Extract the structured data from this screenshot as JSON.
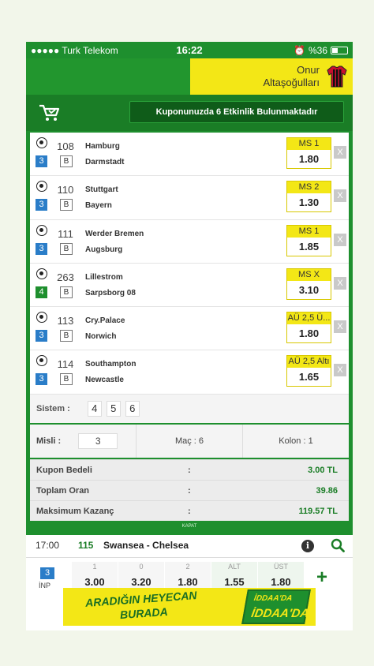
{
  "status": {
    "carrier": "●●●●● Turk Telekom",
    "time": "16:22",
    "battery": "%36"
  },
  "user": {
    "first_name": "Onur",
    "last_name": "Altaşoğulları"
  },
  "coupon": {
    "message": "Kuponunuzda 6 Etkinlik Bulunmaktadır"
  },
  "selections": [
    {
      "code": "108",
      "mbs": "3",
      "mbs_color": "#2a7dc8",
      "type": "B",
      "home": "Hamburg",
      "away": "Darmstadt",
      "bet_type": "MS 1",
      "odd": "1.80"
    },
    {
      "code": "110",
      "mbs": "3",
      "mbs_color": "#2a7dc8",
      "type": "B",
      "home": "Stuttgart",
      "away": "Bayern",
      "bet_type": "MS 2",
      "odd": "1.30"
    },
    {
      "code": "111",
      "mbs": "3",
      "mbs_color": "#2a7dc8",
      "type": "B",
      "home": "Werder Bremen",
      "away": "Augsburg",
      "bet_type": "MS 1",
      "odd": "1.85"
    },
    {
      "code": "263",
      "mbs": "4",
      "mbs_color": "#1e8f2e",
      "type": "B",
      "home": "Lillestrom",
      "away": "Sarpsborg 08",
      "bet_type": "MS X",
      "odd": "3.10"
    },
    {
      "code": "113",
      "mbs": "3",
      "mbs_color": "#2a7dc8",
      "type": "B",
      "home": "Cry.Palace",
      "away": "Norwich",
      "bet_type": "AÜ 2,5 Ü...",
      "odd": "1.80"
    },
    {
      "code": "114",
      "mbs": "3",
      "mbs_color": "#2a7dc8",
      "type": "B",
      "home": "Southampton",
      "away": "Newcastle",
      "bet_type": "AÜ 2,5 Altı",
      "odd": "1.65"
    }
  ],
  "remove_label": "X",
  "sistem": {
    "label": "Sistem :",
    "options": [
      "4",
      "5",
      "6"
    ]
  },
  "misli": {
    "label": "Misli :",
    "value": "3",
    "mac": "Maç : 6",
    "kolon": "Kolon : 1"
  },
  "summary": [
    {
      "label": "Kupon Bedeli",
      "colon": ":",
      "value": "3.00 TL"
    },
    {
      "label": "Toplam Oran",
      "colon": ":",
      "value": "39.86"
    },
    {
      "label": "Maksimum Kazanç",
      "colon": ":",
      "value": "119.57 TL"
    }
  ],
  "close_tab": "KAPAT",
  "match": {
    "time": "17:00",
    "code": "115",
    "teams": "Swansea - Chelsea",
    "mbs": "3",
    "status": "İNP",
    "odds": [
      {
        "header": "1",
        "value": "3.00"
      },
      {
        "header": "0",
        "value": "3.20"
      },
      {
        "header": "2",
        "value": "1.80"
      },
      {
        "header": "ALT",
        "value": "1.55"
      },
      {
        "header": "ÜST",
        "value": "1.80"
      }
    ],
    "add_label": "+"
  },
  "banner": {
    "line1": "ARADIĞIN HEYECAN",
    "line2": "BURADA",
    "logo_top": "İDDAA'DA",
    "logo_bottom": "İDDAA'DA"
  }
}
